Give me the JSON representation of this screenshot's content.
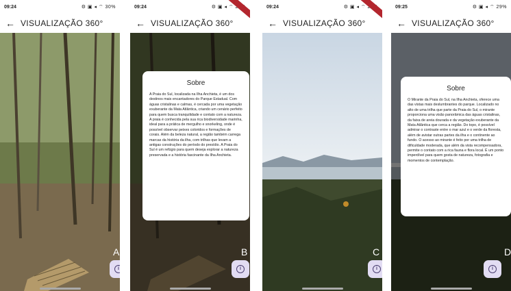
{
  "screens": [
    {
      "status": {
        "time": "09:24",
        "right": "⚙ ▣ ◂ ⌔ 30%"
      },
      "appbar": {
        "title": "VISUALIZAÇÃO 360°"
      },
      "label": "A"
    },
    {
      "status": {
        "time": "09:24",
        "right": "⚙ ▣ ◂ ⌔ 29%"
      },
      "appbar": {
        "title": "VISUALIZAÇÃO 360°"
      },
      "label": "B",
      "dialog": {
        "title": "Sobre",
        "body": "A Praia do Sul, localizada na Ilha Anchieta, é um dos destinos mais encantadores do Parque Estadual. Com águas cristalinas e calmas, é cercada por uma vegetação exuberante da Mata Atlântica, criando um cenário perfeito para quem busca tranquilidade e contato com a natureza. A praia é conhecida pela sua rica biodiversidade marinha, ideal para a prática de mergulho e snorkeling, onde é possível observar peixes coloridos e formações de corais. Além da beleza natural, a região também carrega marcas da história da ilha, com trilhas que levam a antigas construções do período do presídio. A Praia do Sul é um refúgio para quem deseja explorar a natureza preservada e a história fascinante da Ilha Anchieta."
      }
    },
    {
      "status": {
        "time": "09:24",
        "right": "⚙ ▣ ◂ ⌔ 29%"
      },
      "appbar": {
        "title": "VISUALIZAÇÃO 360°"
      },
      "label": "C"
    },
    {
      "status": {
        "time": "09:25",
        "right": "⚙ ▣ ◂ ⌔ 29%"
      },
      "appbar": {
        "title": "VISUALIZAÇÃO 360°"
      },
      "label": "D",
      "dialog": {
        "title": "Sobre",
        "body": "O Mirante da Praia do Sul, na Ilha Anchieta, oferece uma das vistas mais deslumbrantes do parque. Localizado no alto de uma trilha que parte da Praia do Sul, o mirante proporciona uma visão panorâmica das águas cristalinas, da faixa de areia dourada e da vegetação exuberante da Mata Atlântica que cerca a região. Do topo, é possível admirar o contraste entre o mar azul e o verde da floresta, além de avistar outras partes da ilha e o continente ao fundo. O acesso ao mirante é feito por uma trilha de dificuldade moderada, que além da vista recompensadora, permite o contato com a rica fauna e flora local. É um ponto imperdível para quem gosta de natureza, fotografia e momentos de contemplação."
      }
    }
  ],
  "icons": {
    "back": "arrow-left-icon",
    "info": "info-icon"
  }
}
